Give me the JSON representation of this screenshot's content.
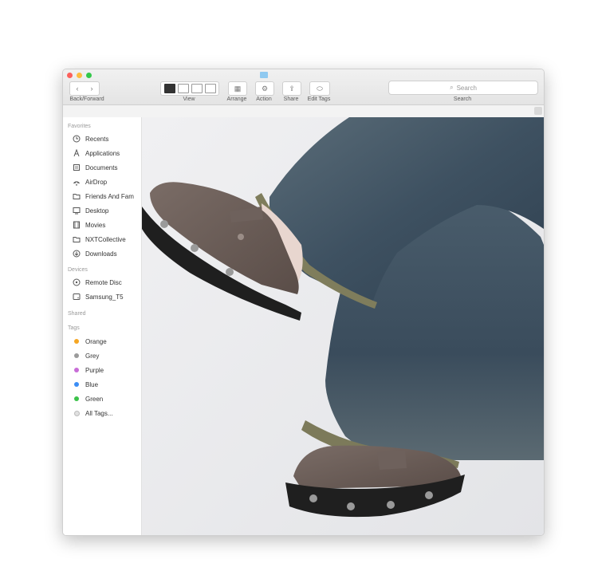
{
  "window": {
    "toolbar": {
      "back_forward_caption": "Back/Forward",
      "back_glyph": "‹",
      "forward_glyph": "›",
      "view_caption": "View",
      "arrange_caption": "Arrange",
      "action_caption": "Action",
      "share_caption": "Share",
      "edit_tags_caption": "Edit Tags",
      "search_placeholder": "Search",
      "search_caption": "Search"
    },
    "sidebar": {
      "favorites_header": "Favorites",
      "favorites": [
        {
          "label": "Recents",
          "icon": "clock-icon"
        },
        {
          "label": "Applications",
          "icon": "applications-icon"
        },
        {
          "label": "Documents",
          "icon": "document-icon"
        },
        {
          "label": "AirDrop",
          "icon": "airdrop-icon"
        },
        {
          "label": "Friends And Fam",
          "icon": "folder-icon"
        },
        {
          "label": "Desktop",
          "icon": "desktop-icon"
        },
        {
          "label": "Movies",
          "icon": "film-icon"
        },
        {
          "label": "NXTCollective",
          "icon": "folder-icon"
        },
        {
          "label": "Downloads",
          "icon": "download-icon"
        }
      ],
      "devices_header": "Devices",
      "devices": [
        {
          "label": "Remote Disc",
          "icon": "disc-icon"
        },
        {
          "label": "Samsung_T5",
          "icon": "drive-icon"
        }
      ],
      "shared_header": "Shared",
      "tags_header": "Tags",
      "tags": [
        {
          "label": "Orange",
          "color": "#f5a623"
        },
        {
          "label": "Grey",
          "color": "#9b9b9b"
        },
        {
          "label": "Purple",
          "color": "#c86dd7"
        },
        {
          "label": "Blue",
          "color": "#3b8df5"
        },
        {
          "label": "Green",
          "color": "#3cc24a"
        },
        {
          "label": "All Tags...",
          "color": "#e0e0e0"
        }
      ]
    }
  },
  "photo": {
    "subject": "jeans-and-clogs-photo",
    "denim_color": "#3e5161",
    "clog_color": "#6b5d57",
    "sole_color": "#1f1f1f"
  }
}
